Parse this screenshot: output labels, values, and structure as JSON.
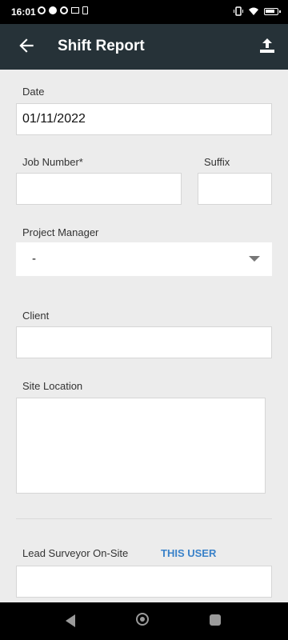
{
  "status_bar": {
    "time": "16:01"
  },
  "app_bar": {
    "title": "Shift Report"
  },
  "form": {
    "date": {
      "label": "Date",
      "value": "01/11/2022"
    },
    "job_number": {
      "label": "Job Number*",
      "value": ""
    },
    "suffix": {
      "label": "Suffix",
      "value": ""
    },
    "project_manager": {
      "label": "Project Manager",
      "value": "-"
    },
    "client": {
      "label": "Client",
      "value": ""
    },
    "site_location": {
      "label": "Site Location",
      "value": ""
    },
    "lead_surveyor": {
      "label": "Lead Surveyor On-Site",
      "action": "THIS USER",
      "value": ""
    }
  },
  "colors": {
    "app_bar_bg": "#263238",
    "link": "#3a82c9"
  }
}
